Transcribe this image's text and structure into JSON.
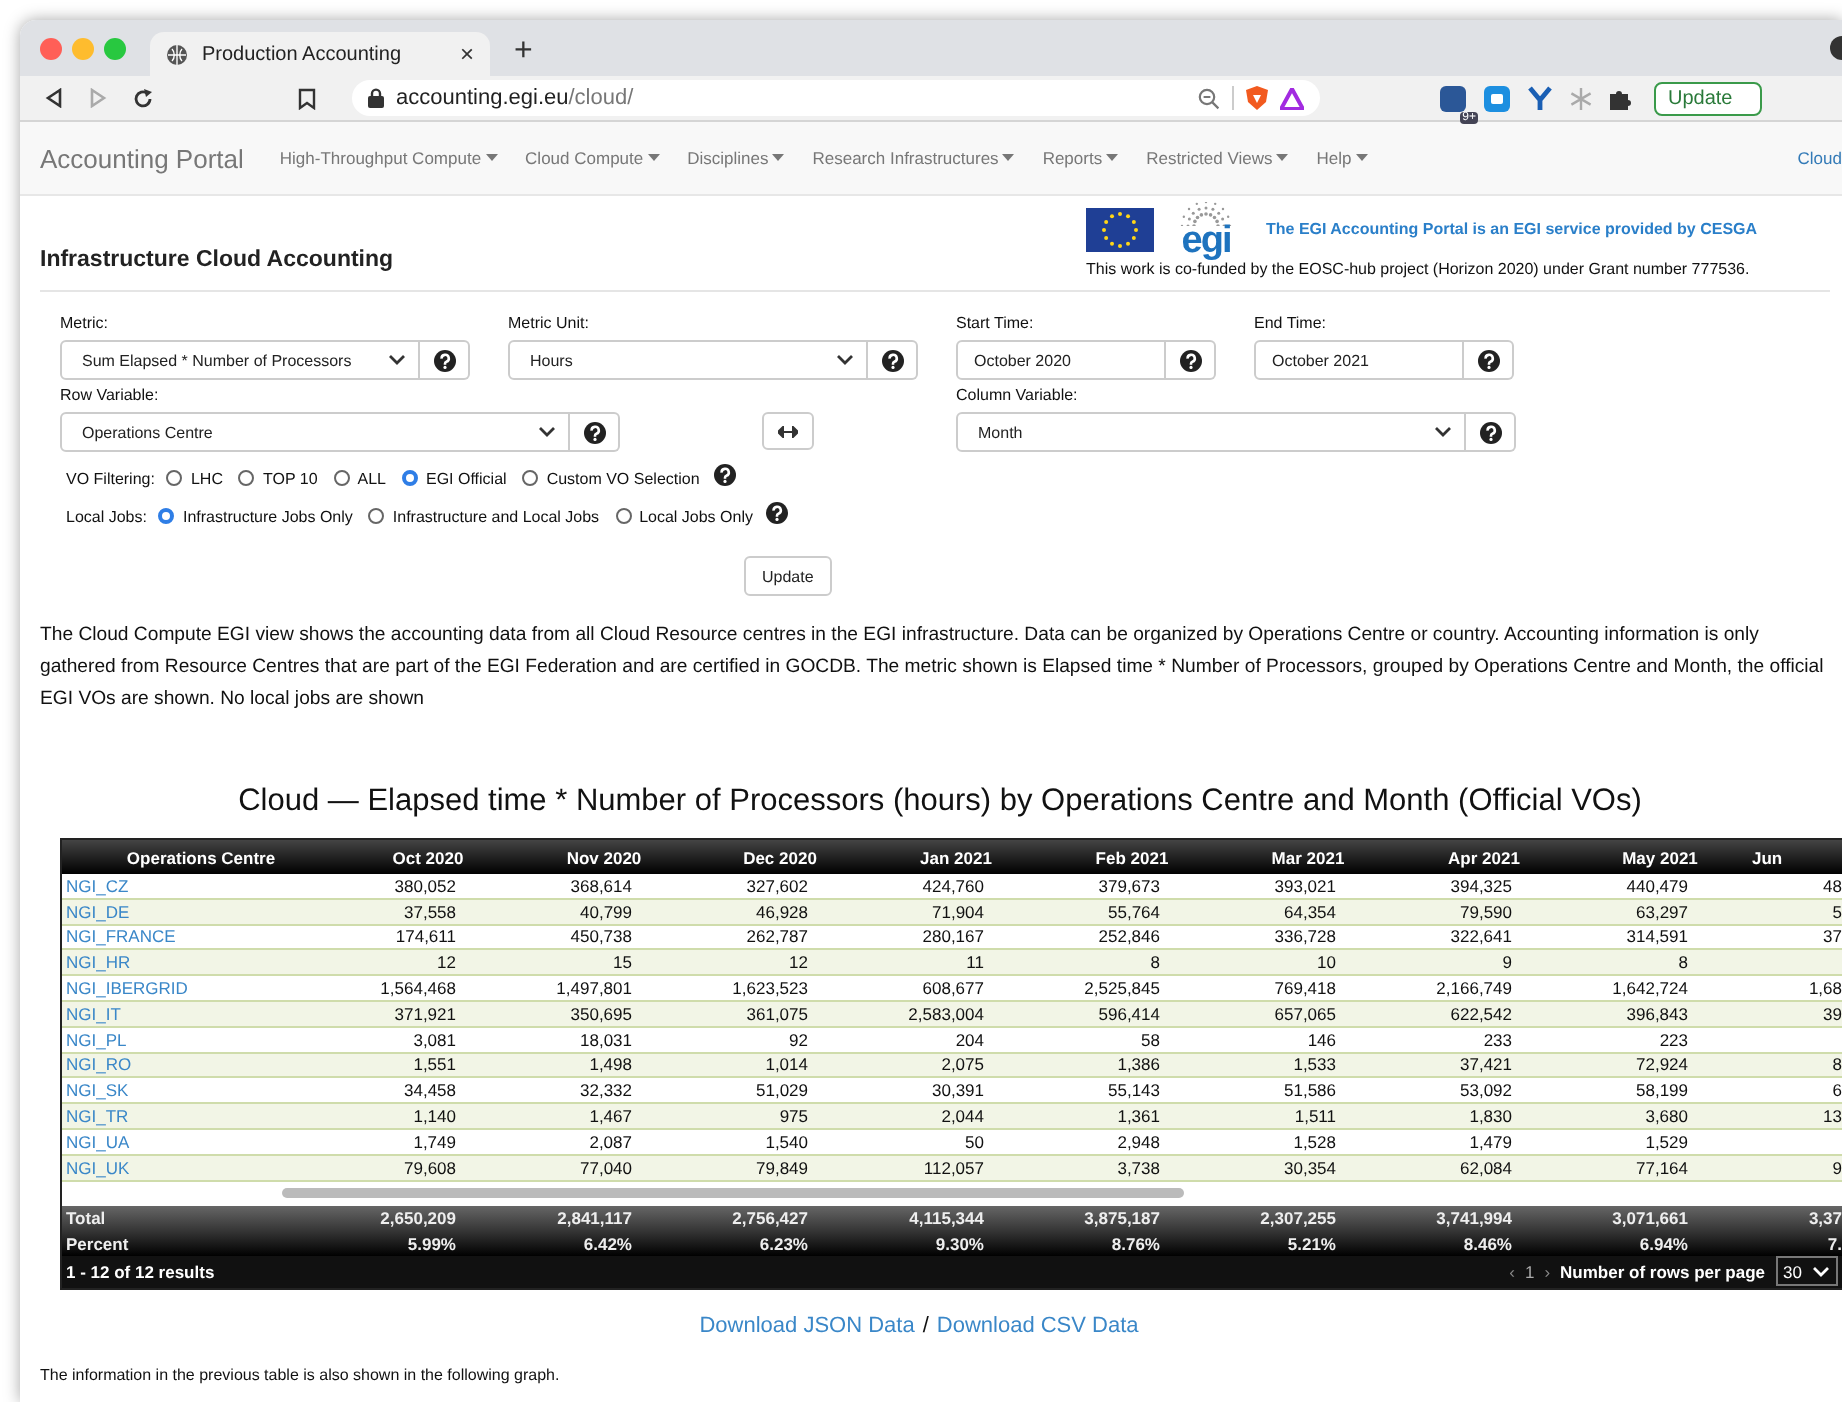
{
  "browser": {
    "tab_title": "Production Accounting",
    "tab_close": "×",
    "new_tab": "+",
    "url_host": "accounting.egi.eu",
    "url_path": "/cloud/",
    "extension_badge": "9+",
    "update_button": "Update"
  },
  "navbar": {
    "brand": "Accounting Portal",
    "items": [
      "High-Throughput Compute",
      "Cloud Compute",
      "Disciplines",
      "Research Infrastructures",
      "Reports",
      "Restricted Views",
      "Help"
    ],
    "right_item": "Cloud"
  },
  "header": {
    "title": "Infrastructure Cloud Accounting",
    "logo_text": "egi",
    "service_note": "The EGI Accounting Portal is an EGI service provided by CESGA",
    "funding_note": "This work is co-funded by the EOSC-hub project (Horizon 2020) under Grant number 777536."
  },
  "form": {
    "fields": [
      {
        "kind": "select",
        "label": "Metric:",
        "value": "Sum Elapsed * Number of Processors"
      },
      {
        "kind": "select",
        "label": "Metric Unit:",
        "value": "Hours"
      },
      {
        "kind": "input",
        "label": "Start Time:",
        "value": "October 2020"
      },
      {
        "kind": "input",
        "label": "End Time:",
        "value": "October 2021"
      },
      {
        "kind": "select",
        "label": "Row Variable:",
        "value": "Operations Centre"
      },
      {
        "kind": "select",
        "label": "Column Variable:",
        "value": "Month"
      }
    ],
    "radio_groups": [
      {
        "label": "VO Filtering:",
        "options": [
          {
            "label": "LHC",
            "selected": false
          },
          {
            "label": "TOP 10",
            "selected": false
          },
          {
            "label": "ALL",
            "selected": false
          },
          {
            "label": "EGI Official",
            "selected": true
          },
          {
            "label": "Custom VO Selection",
            "selected": false
          }
        ]
      },
      {
        "label": "Local Jobs:",
        "options": [
          {
            "label": "Infrastructure Jobs Only",
            "selected": true
          },
          {
            "label": "Infrastructure and Local Jobs",
            "selected": false
          },
          {
            "label": "Local Jobs Only",
            "selected": false
          }
        ]
      }
    ],
    "update_button": "Update"
  },
  "description": "The Cloud Compute EGI view shows the accounting data from all Cloud Resource centres in the EGI infrastructure. Data can be organized by Operations Centre or country. Accounting information is only gathered from Resource Centres that are part of the EGI Federation and are certified in GOCDB. The metric shown is Elapsed time * Number of Processors, grouped by Operations Centre and Month, the official EGI VOs are shown. No local jobs are shown",
  "table": {
    "title": "Cloud — Elapsed time * Number of Processors (hours) by Operations Centre and Month (Official VOs)",
    "columns": [
      "Operations Centre",
      "Oct 2020",
      "Nov 2020",
      "Dec 2020",
      "Jan 2021",
      "Feb 2021",
      "Mar 2021",
      "Apr 2021",
      "May 2021",
      "Jun"
    ],
    "rows": [
      {
        "centre": "NGI_CZ",
        "values": [
          "380,052",
          "368,614",
          "327,602",
          "424,760",
          "379,673",
          "393,021",
          "394,325",
          "440,479",
          "48"
        ]
      },
      {
        "centre": "NGI_DE",
        "values": [
          "37,558",
          "40,799",
          "46,928",
          "71,904",
          "55,764",
          "64,354",
          "79,590",
          "63,297",
          "5"
        ]
      },
      {
        "centre": "NGI_FRANCE",
        "values": [
          "174,611",
          "450,738",
          "262,787",
          "280,167",
          "252,846",
          "336,728",
          "322,641",
          "314,591",
          "37"
        ]
      },
      {
        "centre": "NGI_HR",
        "values": [
          "12",
          "15",
          "12",
          "11",
          "8",
          "10",
          "9",
          "8"
        ]
      },
      {
        "centre": "NGI_IBERGRID",
        "values": [
          "1,564,468",
          "1,497,801",
          "1,623,523",
          "608,677",
          "2,525,845",
          "769,418",
          "2,166,749",
          "1,642,724",
          "1,68"
        ]
      },
      {
        "centre": "NGI_IT",
        "values": [
          "371,921",
          "350,695",
          "361,075",
          "2,583,004",
          "596,414",
          "657,065",
          "622,542",
          "396,843",
          "39"
        ]
      },
      {
        "centre": "NGI_PL",
        "values": [
          "3,081",
          "18,031",
          "92",
          "204",
          "58",
          "146",
          "233",
          "223"
        ]
      },
      {
        "centre": "NGI_RO",
        "values": [
          "1,551",
          "1,498",
          "1,014",
          "2,075",
          "1,386",
          "1,533",
          "37,421",
          "72,924",
          "8"
        ]
      },
      {
        "centre": "NGI_SK",
        "values": [
          "34,458",
          "32,332",
          "51,029",
          "30,391",
          "55,143",
          "51,586",
          "53,092",
          "58,199",
          "6"
        ]
      },
      {
        "centre": "NGI_TR",
        "values": [
          "1,140",
          "1,467",
          "975",
          "2,044",
          "1,361",
          "1,511",
          "1,830",
          "3,680",
          "13"
        ]
      },
      {
        "centre": "NGI_UA",
        "values": [
          "1,749",
          "2,087",
          "1,540",
          "50",
          "2,948",
          "1,528",
          "1,479",
          "1,529"
        ]
      },
      {
        "centre": "NGI_UK",
        "values": [
          "79,608",
          "77,040",
          "79,849",
          "112,057",
          "3,738",
          "30,354",
          "62,084",
          "77,164",
          "9"
        ]
      }
    ],
    "total": {
      "label": "Total",
      "values": [
        "2,650,209",
        "2,841,117",
        "2,756,427",
        "4,115,344",
        "3,875,187",
        "2,307,255",
        "3,741,994",
        "3,071,661",
        "3,37"
      ]
    },
    "percent": {
      "label": "Percent",
      "values": [
        "5.99%",
        "6.42%",
        "6.23%",
        "9.30%",
        "8.76%",
        "5.21%",
        "8.46%",
        "6.94%",
        "7."
      ]
    },
    "results": "1 - 12 of 12 results",
    "pager": {
      "prev": "‹",
      "page": "1",
      "next": "›"
    },
    "rows_per_page_label": "Number of rows per page",
    "rows_per_page": "30"
  },
  "downloads": {
    "json": "Download JSON Data",
    "separator": "/",
    "csv": "Download CSV Data"
  },
  "footer_note": "The information in the previous table is also shown in the following graph."
}
